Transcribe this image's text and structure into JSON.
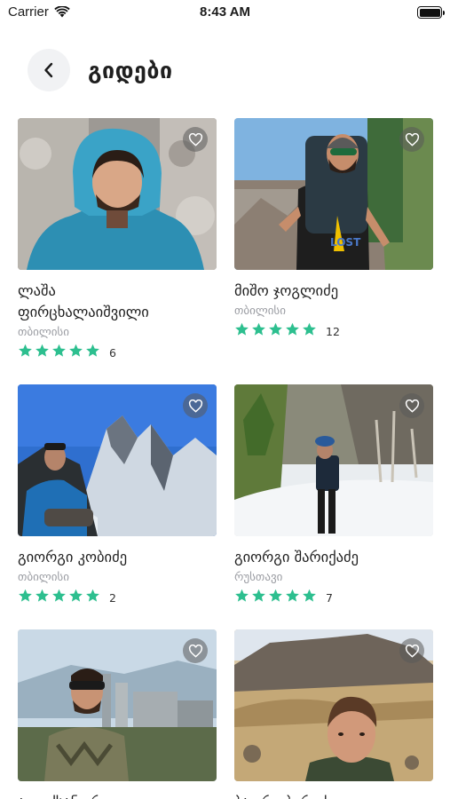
{
  "status_bar": {
    "carrier": "Carrier",
    "time": "8:43 AM"
  },
  "header": {
    "title": "გიდები",
    "back_icon": "chevron-left-icon"
  },
  "colors": {
    "star": "#2dbf8f",
    "back_bg": "#f1f2f4",
    "city": "#9a9ca2"
  },
  "guides": [
    {
      "name_lines": [
        "ლაშა",
        "ფირცხალაიშვილი"
      ],
      "city": "თბილისი",
      "stars": 5,
      "reviews": "6"
    },
    {
      "name_lines": [
        "მიშო ჯოგლიძე"
      ],
      "city": "თბილისი",
      "stars": 5,
      "reviews": "12"
    },
    {
      "name_lines": [
        "გიორგი კობიძე"
      ],
      "city": "თბილისი",
      "stars": 5,
      "reviews": "2"
    },
    {
      "name_lines": [
        "გიორგი შარიქაძე"
      ],
      "city": "რუსთავი",
      "stars": 5,
      "reviews": "7"
    },
    {
      "name_lines": [
        "ალექსანდრე"
      ],
      "city": "",
      "stars": 0,
      "reviews": ""
    },
    {
      "name_lines": [
        "ბადრი ბერიძე"
      ],
      "city": "",
      "stars": 0,
      "reviews": ""
    }
  ]
}
